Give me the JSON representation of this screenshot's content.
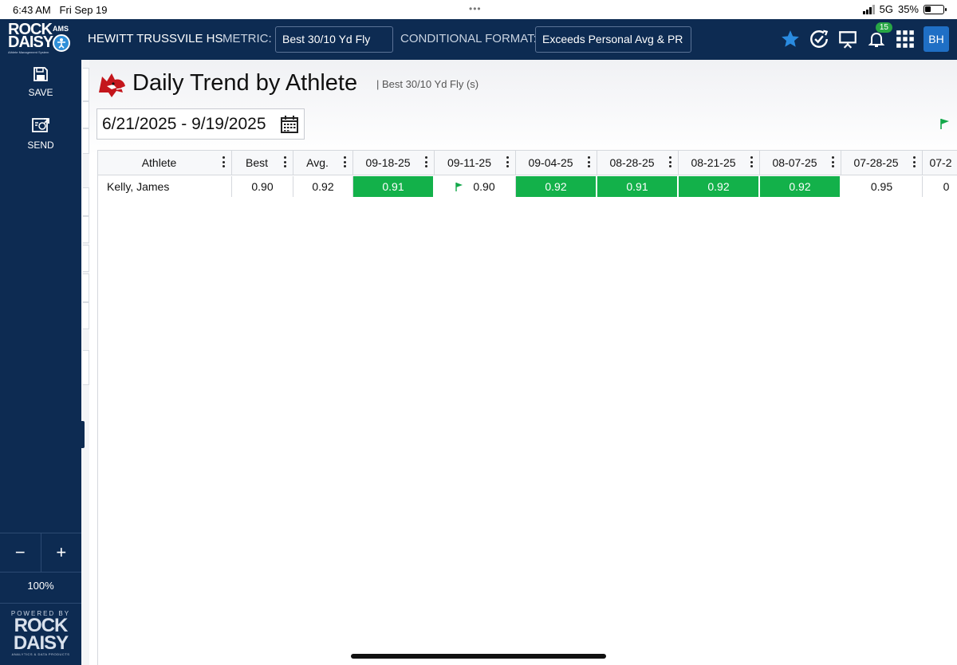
{
  "status_bar": {
    "time": "6:43 AM",
    "date": "Fri Sep 19",
    "network": "5G",
    "battery": "35%",
    "battery_level": 0.35
  },
  "app": {
    "logo_top": "ROCK",
    "logo_bottom": "DAISY",
    "logo_ams": "AMS",
    "logo_sub": "Athlete Management System",
    "org_name": "HEWITT TRUSSVILE HS",
    "metric_label": "METRIC:",
    "metric_value": "Best 30/10 Yd Fly (s)",
    "cf_label": "CONDITIONAL FORMAT:",
    "cf_value": "Exceeds Personal Avg & PR",
    "notification_count": "15",
    "user_initials": "BH",
    "accent_color": "#0d2b52",
    "highlight_color": "#13b14a"
  },
  "sidebar": {
    "save_label": "SAVE",
    "send_label": "SEND",
    "zoom_out": "−",
    "zoom_in": "+",
    "zoom_level": "100%",
    "powered_by": "POWERED BY",
    "powered_rock": "ROCK",
    "powered_daisy": "DAISY",
    "powered_tag": "ANALYTICS & DATA PRODUCTS"
  },
  "page": {
    "title": "Daily Trend by Athlete",
    "subtitle": "| Best 30/10 Yd Fly (s)",
    "date_range": "6/21/2025 - 9/19/2025"
  },
  "table": {
    "columns": [
      "Athlete",
      "Best",
      "Avg.",
      "09-18-25",
      "09-11-25",
      "09-04-25",
      "08-28-25",
      "08-21-25",
      "08-07-25",
      "07-28-25",
      "07-2"
    ],
    "rows": [
      {
        "athlete": "Kelly, James",
        "best": "0.90",
        "avg": "0.92",
        "values": [
          "0.91",
          "0.90",
          "0.92",
          "0.91",
          "0.92",
          "0.92",
          "0.95",
          "0"
        ]
      }
    ]
  }
}
